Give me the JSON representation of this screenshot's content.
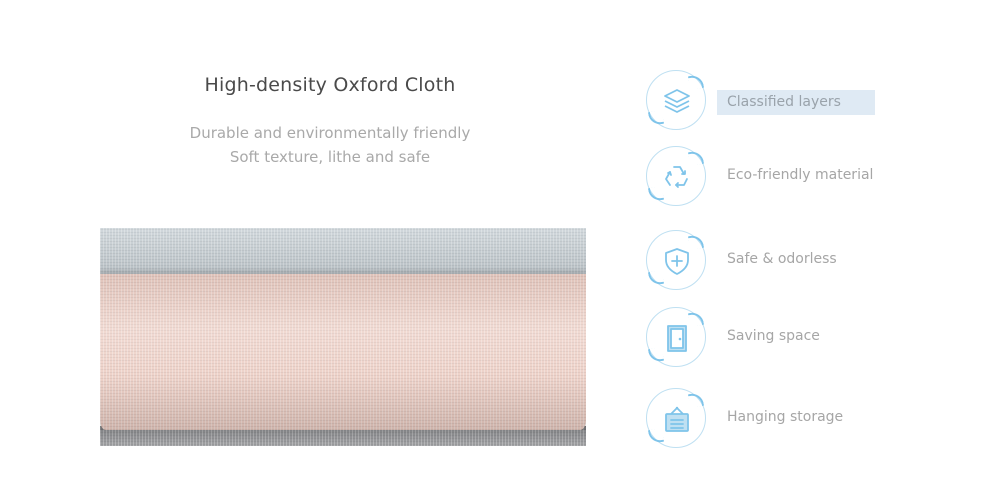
{
  "heading": {
    "title": "High-density Oxford Cloth",
    "line1": "Durable and environmentally friendly",
    "line2": "Soft texture, lithe and safe"
  },
  "colors": {
    "accent": "#7fc4ea",
    "circle_border": "#bfe0f2",
    "highlight": "#dfeaf4",
    "fabric_blue": "#c9d1d6",
    "fabric_pink": "#eccdc3",
    "fabric_grey": "#9b9c9f"
  },
  "features": [
    {
      "icon": "layers-icon",
      "label": "Classified layers",
      "highlighted": true
    },
    {
      "icon": "recycle-icon",
      "label": "Eco-friendly material"
    },
    {
      "icon": "shield-icon",
      "label": "Safe & odorless"
    },
    {
      "icon": "door-icon",
      "label": "Saving space"
    },
    {
      "icon": "hanging-storage-icon",
      "label": "Hanging storage"
    }
  ]
}
